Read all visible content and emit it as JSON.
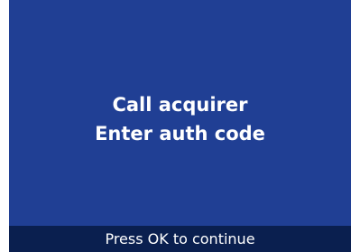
{
  "screen": {
    "message_lines": [
      "Call acquirer",
      "Enter auth code"
    ],
    "footer_text": "Press OK to continue"
  },
  "colors": {
    "panel_bg": "#203f94",
    "footer_bg": "#0a1f4f",
    "text": "#ffffff"
  }
}
